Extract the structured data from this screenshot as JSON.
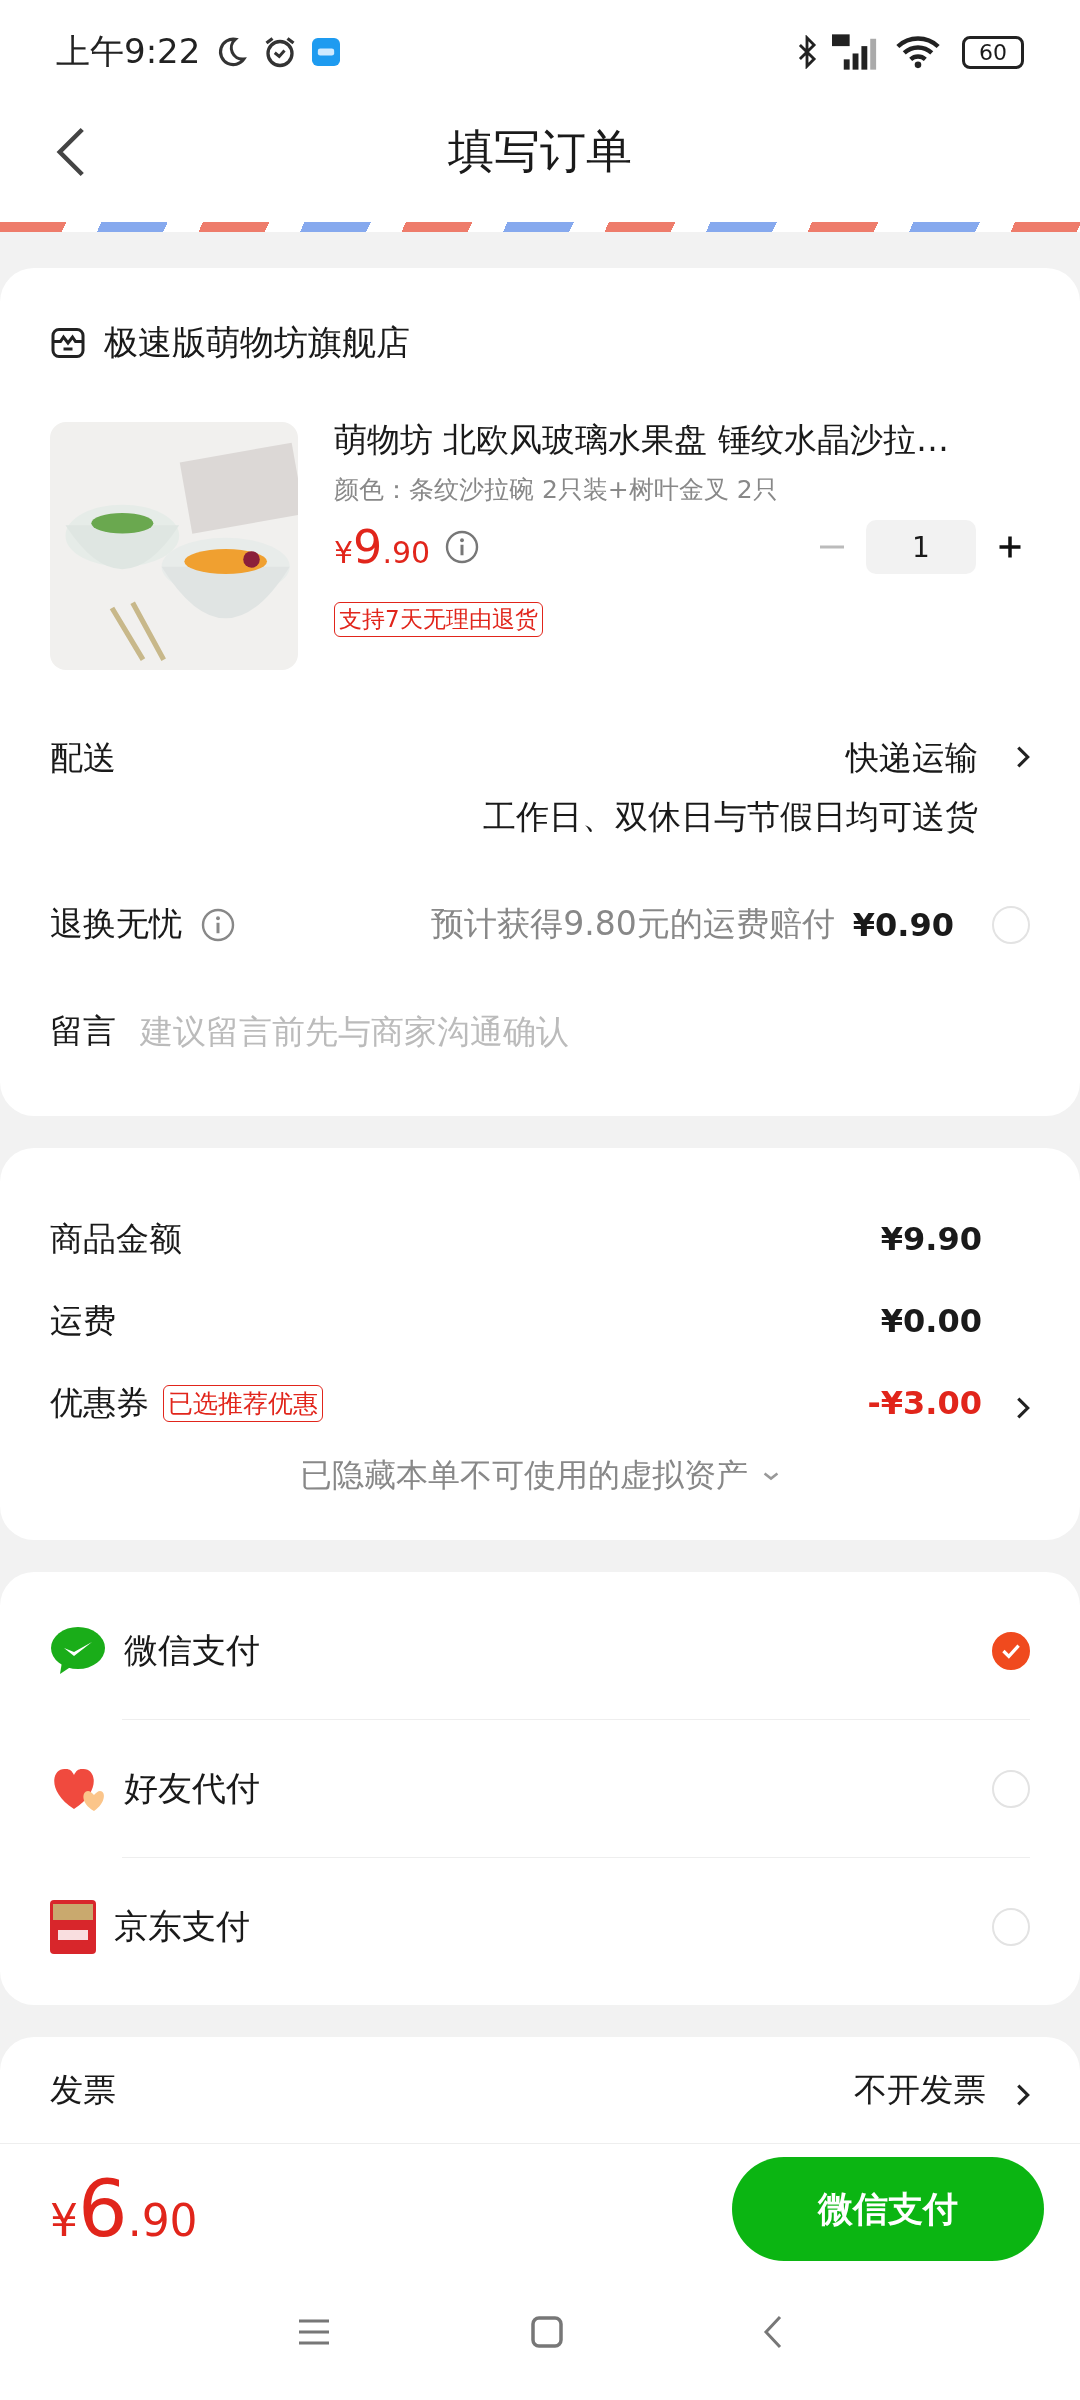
{
  "status_bar": {
    "time": "上午9:22",
    "battery": "60"
  },
  "header": {
    "title": "填写订单"
  },
  "store": {
    "name": "极速版萌物坊旗舰店"
  },
  "product": {
    "title": "萌物坊 北欧风玻璃水果盘 锤纹水晶沙拉…",
    "variant": "颜色：条纹沙拉碗 2只装+树叶金叉 2只",
    "price_symbol": "¥",
    "price_int": "9",
    "price_dec": ".90",
    "quantity": "1",
    "minus_disabled": true,
    "tag": "支持7天无理由退货"
  },
  "delivery": {
    "label": "配送",
    "value": "快递运输",
    "note": "工作日、双休日与节假日均可送货"
  },
  "return_insurance": {
    "label": "退换无忧",
    "description": "预计获得9.80元的运费赔付",
    "price": "¥0.90",
    "checked": false
  },
  "message": {
    "label": "留言",
    "placeholder": "建议留言前先与商家沟通确认"
  },
  "summary": {
    "rows": [
      {
        "kind": "plain",
        "label": "商品金额",
        "value": "¥9.90"
      },
      {
        "kind": "plain",
        "label": "运费",
        "value": "¥0.00"
      },
      {
        "kind": "discount",
        "label": "优惠券",
        "tag": "已选推荐优惠",
        "value": "-¥3.00"
      }
    ],
    "hidden_note": "已隐藏本单不可使用的虚拟资产"
  },
  "payment_methods": [
    {
      "kind": "wechat",
      "name": "微信支付",
      "selected": true
    },
    {
      "kind": "friend",
      "name": "好友代付",
      "selected": false
    },
    {
      "kind": "jd",
      "name": "京东支付",
      "selected": false
    }
  ],
  "invoice": {
    "label": "发票",
    "value": "不开发票"
  },
  "footer": {
    "total_symbol": "¥",
    "total_int": "6",
    "total_dec": ".90",
    "pay_button": "微信支付"
  }
}
